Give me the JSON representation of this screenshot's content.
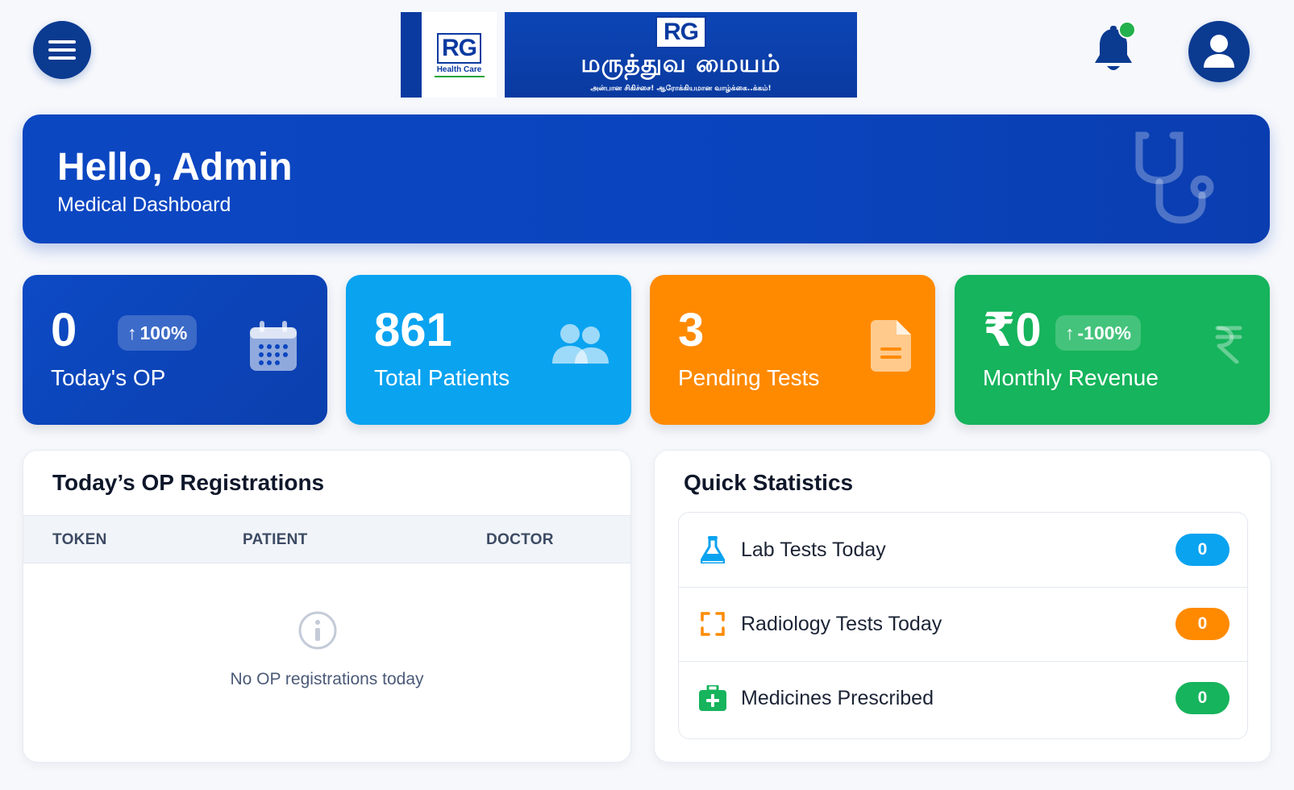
{
  "header": {
    "menu_icon": "hamburger-menu-icon",
    "logo": {
      "mark_text": "RG",
      "mark_sub": "Health Care",
      "banner_rg": "RG",
      "banner_tamil": "மருத்துவ மையம்",
      "banner_tagline": "அன்பான சிகிச்சை! ஆரோக்கியமான வாழ்க்கை..க்கம்!"
    },
    "notification_icon": "bell-icon",
    "notification_dot_color": "#22b14c",
    "profile_icon": "user-icon"
  },
  "hero": {
    "greeting": "Hello, Admin",
    "subtitle": "Medical Dashboard",
    "icon": "stethoscope-icon"
  },
  "stats": [
    {
      "value": "0",
      "label": "Today's OP",
      "badge": "100%",
      "badge_arrow": "↑",
      "icon": "calendar-icon",
      "color": "#0b44bb"
    },
    {
      "value": "861",
      "label": "Total Patients",
      "icon": "users-icon",
      "color": "#0aa3f0"
    },
    {
      "value": "3",
      "label": "Pending Tests",
      "icon": "file-icon",
      "color": "#ff8a00"
    },
    {
      "value": "₹0",
      "label": "Monthly Revenue",
      "badge": "-100%",
      "badge_arrow": "↑",
      "icon": "rupee-icon",
      "color": "#16b45c"
    }
  ],
  "op_registrations": {
    "title": "Today’s OP Registrations",
    "columns": [
      "TOKEN",
      "PATIENT",
      "DOCTOR"
    ],
    "rows": [],
    "empty_message": "No OP registrations today",
    "empty_icon": "info-circle-icon"
  },
  "quick_statistics": {
    "title": "Quick Statistics",
    "items": [
      {
        "label": "Lab Tests Today",
        "value": "0",
        "icon": "flask-icon",
        "color": "#0aa3f0"
      },
      {
        "label": "Radiology Tests Today",
        "value": "0",
        "icon": "scan-icon",
        "color": "#ff8a00"
      },
      {
        "label": "Medicines Prescribed",
        "value": "0",
        "icon": "medkit-icon",
        "color": "#16b45c"
      }
    ]
  }
}
